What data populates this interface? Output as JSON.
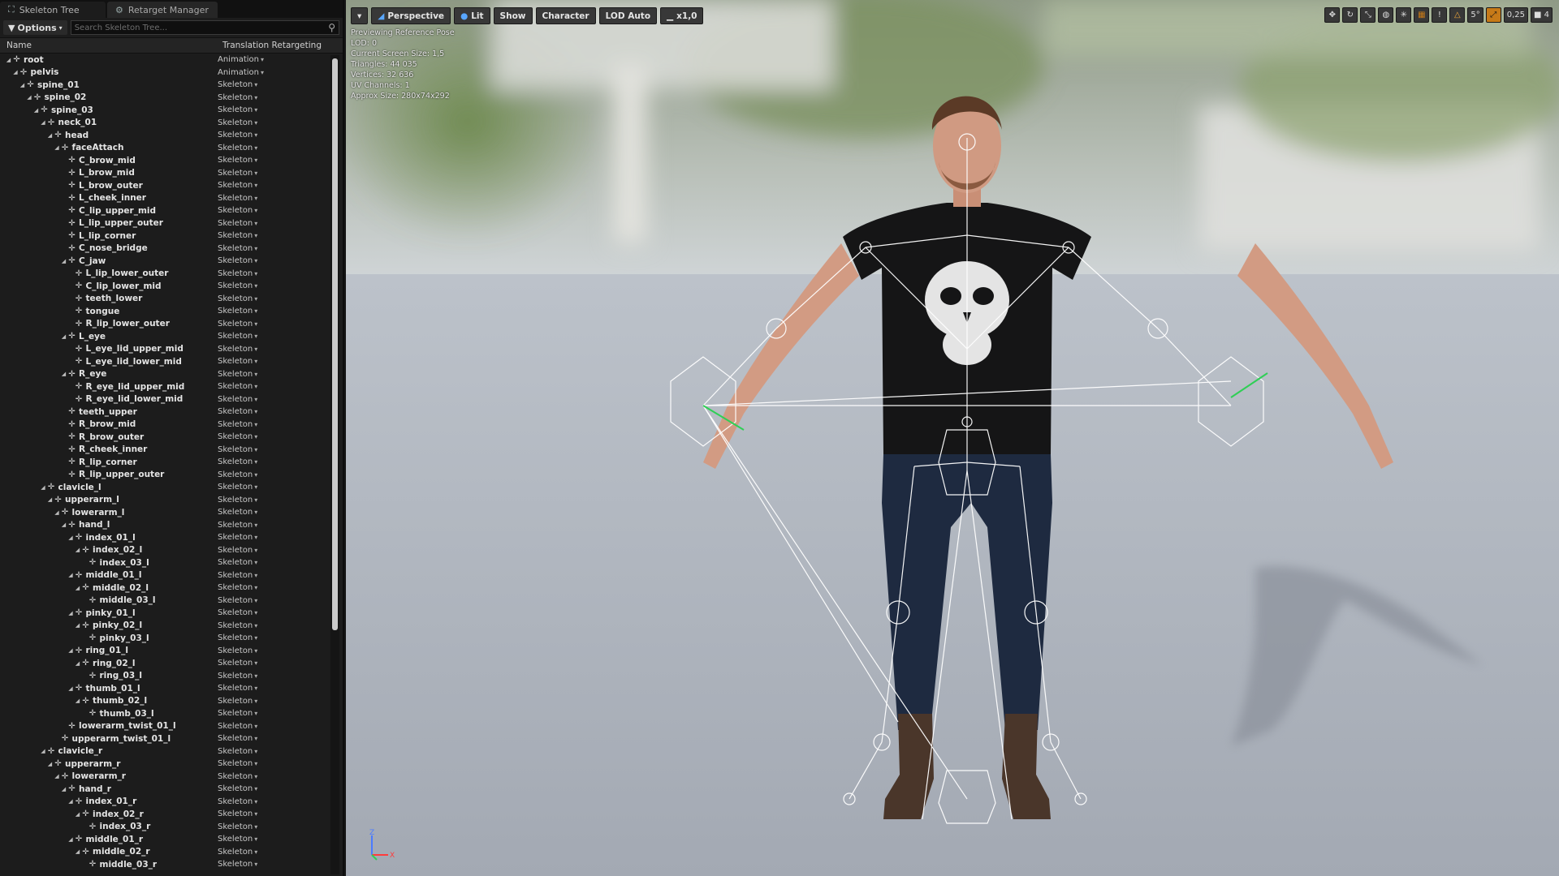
{
  "tabs": [
    {
      "label": "Skeleton Tree",
      "icon": "skeleton-icon"
    },
    {
      "label": "Retarget Manager",
      "icon": "retarget-icon"
    }
  ],
  "search": {
    "options_label": "Options",
    "placeholder": "Search Skeleton Tree..."
  },
  "columns": {
    "name": "Name",
    "translation": "Translation Retargeting"
  },
  "bones": [
    {
      "name": "root",
      "depth": 0,
      "mode": "Animation",
      "expanded": true
    },
    {
      "name": "pelvis",
      "depth": 1,
      "mode": "Animation",
      "expanded": true
    },
    {
      "name": "spine_01",
      "depth": 2,
      "mode": "Skeleton",
      "expanded": true
    },
    {
      "name": "spine_02",
      "depth": 3,
      "mode": "Skeleton",
      "expanded": true
    },
    {
      "name": "spine_03",
      "depth": 4,
      "mode": "Skeleton",
      "expanded": true
    },
    {
      "name": "neck_01",
      "depth": 5,
      "mode": "Skeleton",
      "expanded": true
    },
    {
      "name": "head",
      "depth": 6,
      "mode": "Skeleton",
      "expanded": true
    },
    {
      "name": "faceAttach",
      "depth": 7,
      "mode": "Skeleton",
      "expanded": true
    },
    {
      "name": "C_brow_mid",
      "depth": 8,
      "mode": "Skeleton",
      "expanded": false
    },
    {
      "name": "L_brow_mid",
      "depth": 8,
      "mode": "Skeleton",
      "expanded": false
    },
    {
      "name": "L_brow_outer",
      "depth": 8,
      "mode": "Skeleton",
      "expanded": false
    },
    {
      "name": "L_cheek_inner",
      "depth": 8,
      "mode": "Skeleton",
      "expanded": false
    },
    {
      "name": "C_lip_upper_mid",
      "depth": 8,
      "mode": "Skeleton",
      "expanded": false
    },
    {
      "name": "L_lip_upper_outer",
      "depth": 8,
      "mode": "Skeleton",
      "expanded": false
    },
    {
      "name": "L_lip_corner",
      "depth": 8,
      "mode": "Skeleton",
      "expanded": false
    },
    {
      "name": "C_nose_bridge",
      "depth": 8,
      "mode": "Skeleton",
      "expanded": false
    },
    {
      "name": "C_jaw",
      "depth": 8,
      "mode": "Skeleton",
      "expanded": true
    },
    {
      "name": "L_lip_lower_outer",
      "depth": 9,
      "mode": "Skeleton",
      "expanded": false
    },
    {
      "name": "C_lip_lower_mid",
      "depth": 9,
      "mode": "Skeleton",
      "expanded": false
    },
    {
      "name": "teeth_lower",
      "depth": 9,
      "mode": "Skeleton",
      "expanded": false
    },
    {
      "name": "tongue",
      "depth": 9,
      "mode": "Skeleton",
      "expanded": false
    },
    {
      "name": "R_lip_lower_outer",
      "depth": 9,
      "mode": "Skeleton",
      "expanded": false
    },
    {
      "name": "L_eye",
      "depth": 8,
      "mode": "Skeleton",
      "expanded": true
    },
    {
      "name": "L_eye_lid_upper_mid",
      "depth": 9,
      "mode": "Skeleton",
      "expanded": false
    },
    {
      "name": "L_eye_lid_lower_mid",
      "depth": 9,
      "mode": "Skeleton",
      "expanded": false
    },
    {
      "name": "R_eye",
      "depth": 8,
      "mode": "Skeleton",
      "expanded": true
    },
    {
      "name": "R_eye_lid_upper_mid",
      "depth": 9,
      "mode": "Skeleton",
      "expanded": false
    },
    {
      "name": "R_eye_lid_lower_mid",
      "depth": 9,
      "mode": "Skeleton",
      "expanded": false
    },
    {
      "name": "teeth_upper",
      "depth": 8,
      "mode": "Skeleton",
      "expanded": false
    },
    {
      "name": "R_brow_mid",
      "depth": 8,
      "mode": "Skeleton",
      "expanded": false
    },
    {
      "name": "R_brow_outer",
      "depth": 8,
      "mode": "Skeleton",
      "expanded": false
    },
    {
      "name": "R_cheek_inner",
      "depth": 8,
      "mode": "Skeleton",
      "expanded": false
    },
    {
      "name": "R_lip_corner",
      "depth": 8,
      "mode": "Skeleton",
      "expanded": false
    },
    {
      "name": "R_lip_upper_outer",
      "depth": 8,
      "mode": "Skeleton",
      "expanded": false
    },
    {
      "name": "clavicle_l",
      "depth": 5,
      "mode": "Skeleton",
      "expanded": true
    },
    {
      "name": "upperarm_l",
      "depth": 6,
      "mode": "Skeleton",
      "expanded": true
    },
    {
      "name": "lowerarm_l",
      "depth": 7,
      "mode": "Skeleton",
      "expanded": true
    },
    {
      "name": "hand_l",
      "depth": 8,
      "mode": "Skeleton",
      "expanded": true
    },
    {
      "name": "index_01_l",
      "depth": 9,
      "mode": "Skeleton",
      "expanded": true
    },
    {
      "name": "index_02_l",
      "depth": 10,
      "mode": "Skeleton",
      "expanded": true
    },
    {
      "name": "index_03_l",
      "depth": 11,
      "mode": "Skeleton",
      "expanded": false
    },
    {
      "name": "middle_01_l",
      "depth": 9,
      "mode": "Skeleton",
      "expanded": true
    },
    {
      "name": "middle_02_l",
      "depth": 10,
      "mode": "Skeleton",
      "expanded": true
    },
    {
      "name": "middle_03_l",
      "depth": 11,
      "mode": "Skeleton",
      "expanded": false
    },
    {
      "name": "pinky_01_l",
      "depth": 9,
      "mode": "Skeleton",
      "expanded": true
    },
    {
      "name": "pinky_02_l",
      "depth": 10,
      "mode": "Skeleton",
      "expanded": true
    },
    {
      "name": "pinky_03_l",
      "depth": 11,
      "mode": "Skeleton",
      "expanded": false
    },
    {
      "name": "ring_01_l",
      "depth": 9,
      "mode": "Skeleton",
      "expanded": true
    },
    {
      "name": "ring_02_l",
      "depth": 10,
      "mode": "Skeleton",
      "expanded": true
    },
    {
      "name": "ring_03_l",
      "depth": 11,
      "mode": "Skeleton",
      "expanded": false
    },
    {
      "name": "thumb_01_l",
      "depth": 9,
      "mode": "Skeleton",
      "expanded": true
    },
    {
      "name": "thumb_02_l",
      "depth": 10,
      "mode": "Skeleton",
      "expanded": true
    },
    {
      "name": "thumb_03_l",
      "depth": 11,
      "mode": "Skeleton",
      "expanded": false
    },
    {
      "name": "lowerarm_twist_01_l",
      "depth": 8,
      "mode": "Skeleton",
      "expanded": false
    },
    {
      "name": "upperarm_twist_01_l",
      "depth": 7,
      "mode": "Skeleton",
      "expanded": false
    },
    {
      "name": "clavicle_r",
      "depth": 5,
      "mode": "Skeleton",
      "expanded": true
    },
    {
      "name": "upperarm_r",
      "depth": 6,
      "mode": "Skeleton",
      "expanded": true
    },
    {
      "name": "lowerarm_r",
      "depth": 7,
      "mode": "Skeleton",
      "expanded": true
    },
    {
      "name": "hand_r",
      "depth": 8,
      "mode": "Skeleton",
      "expanded": true
    },
    {
      "name": "index_01_r",
      "depth": 9,
      "mode": "Skeleton",
      "expanded": true
    },
    {
      "name": "index_02_r",
      "depth": 10,
      "mode": "Skeleton",
      "expanded": true
    },
    {
      "name": "index_03_r",
      "depth": 11,
      "mode": "Skeleton",
      "expanded": false
    },
    {
      "name": "middle_01_r",
      "depth": 9,
      "mode": "Skeleton",
      "expanded": true
    },
    {
      "name": "middle_02_r",
      "depth": 10,
      "mode": "Skeleton",
      "expanded": true
    },
    {
      "name": "middle_03_r",
      "depth": 11,
      "mode": "Skeleton",
      "expanded": false
    }
  ],
  "viewport": {
    "toolbar": {
      "perspective": "Perspective",
      "lit": "Lit",
      "show": "Show",
      "character": "Character",
      "lod": "LOD Auto",
      "speed": "x1,0"
    },
    "right_tools": {
      "translate_icon": "move-icon",
      "rotate_icon": "rotate-icon",
      "scale_icon": "scale-icon",
      "grid_snap": "5°",
      "scale_snap": "0,25",
      "camera_speed": "4"
    },
    "info": [
      "Previewing Reference Pose",
      "LOD: 0",
      "Current Screen Size: 1,5",
      "Triangles: 44 035",
      "Vertices: 32 636",
      "UV Channels: 1",
      "Approx Size: 280x74x292"
    ],
    "axis": {
      "z": "Z",
      "x": "X"
    }
  },
  "colors": {
    "accent_blue": "#58a6ff",
    "snap_orange": "#c77a18",
    "warning": "#f2a93b"
  }
}
